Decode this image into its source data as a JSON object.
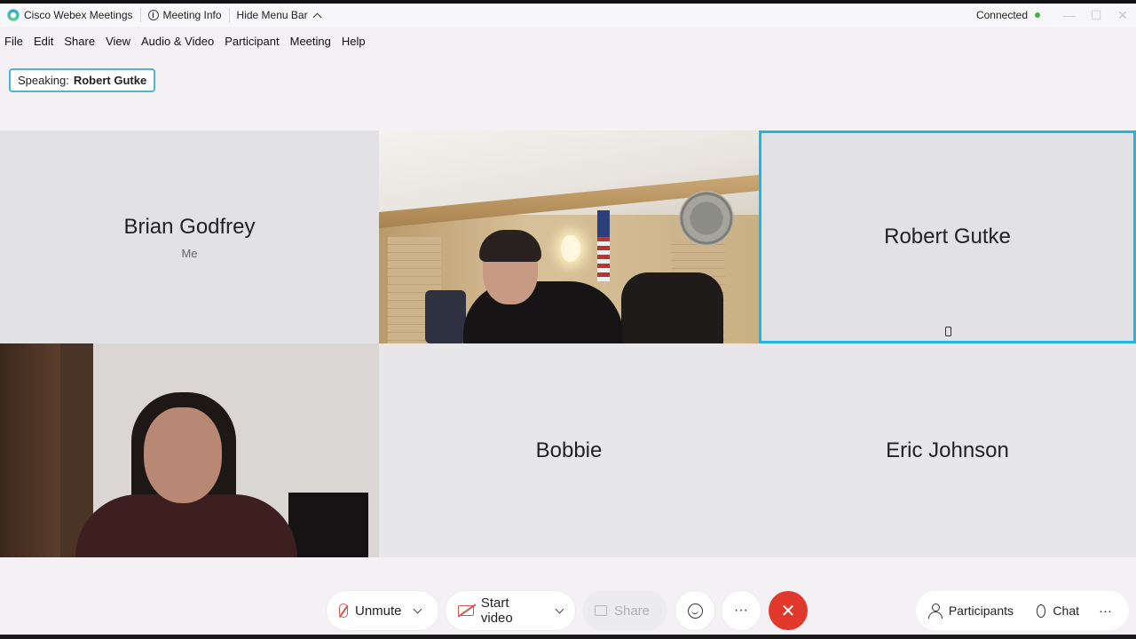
{
  "titlebar": {
    "app_name": "Cisco Webex Meetings",
    "meeting_info": "Meeting Info",
    "hide_menu_bar": "Hide Menu Bar",
    "status": "Connected",
    "status_color": "#4caf50"
  },
  "menu": [
    "File",
    "Edit",
    "Share",
    "View",
    "Audio & Video",
    "Participant",
    "Meeting",
    "Help"
  ],
  "speaking": {
    "label": "Speaking:",
    "name": "Robert Gutke"
  },
  "tiles": [
    {
      "name": "Brian Godfrey",
      "sub": "Me"
    },
    {
      "name": ""
    },
    {
      "name": "Robert Gutke"
    },
    {
      "name": ""
    },
    {
      "name": "Bobbie"
    },
    {
      "name": "Eric Johnson"
    }
  ],
  "toolbar": {
    "unmute": "Unmute",
    "start_video": "Start video",
    "share": "Share",
    "end_icon": "✕",
    "more": "···",
    "participants": "Participants",
    "chat": "Chat"
  },
  "colors": {
    "accent": "#27b3e0",
    "end_call": "#e0392b",
    "muted": "#d9534f"
  }
}
